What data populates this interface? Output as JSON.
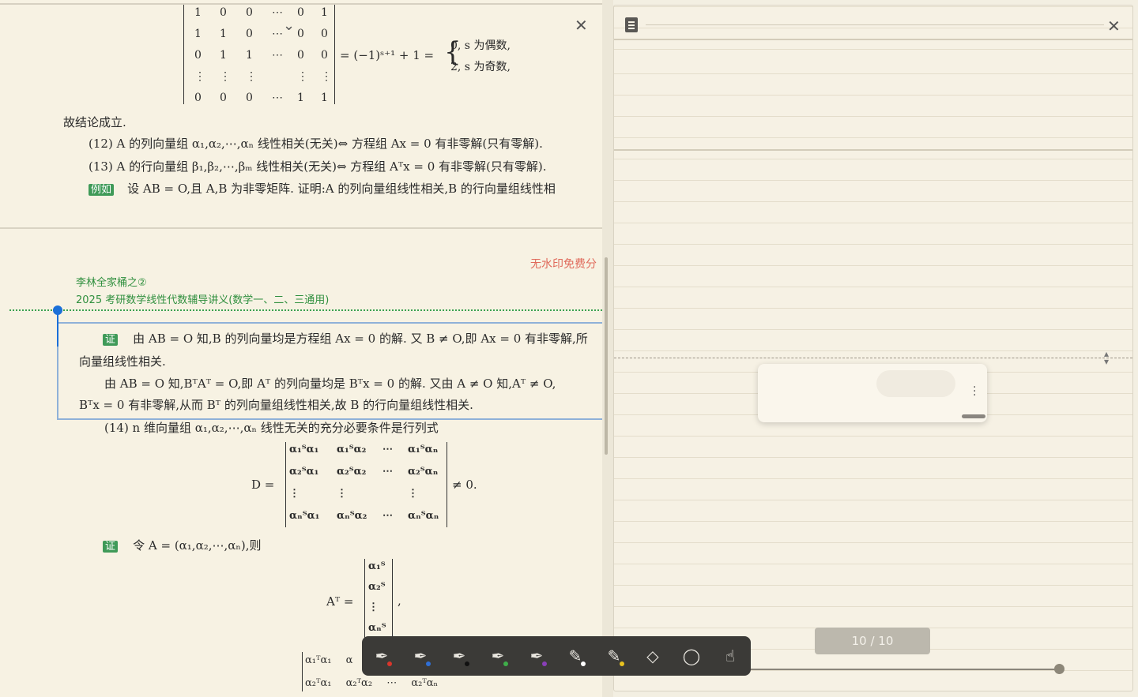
{
  "doc": {
    "matrix_rows": [
      [
        "1",
        "0",
        "0",
        "⋯",
        "0",
        "1"
      ],
      [
        "1",
        "1",
        "0",
        "⋯",
        "0",
        "0"
      ],
      [
        "0",
        "1",
        "1",
        "⋯",
        "0",
        "0"
      ],
      [
        "⋮",
        "⋮",
        "⋮",
        "",
        "⋮",
        "⋮"
      ],
      [
        "0",
        "0",
        "0",
        "⋯",
        "1",
        "1"
      ]
    ],
    "eq_rhs": "= (−1)ˢ⁺¹ + 1 =",
    "case1": "0,   s 为偶数,",
    "case2": "2,   s 为奇数,",
    "conclusion": "故结论成立.",
    "item12": "(12) A 的列向量组 α₁,α₂,⋯,αₙ 线性相关(无关)⇔ 方程组 Ax = 0 有非零解(只有零解).",
    "item13": "(13) A 的行向量组 β₁,β₂,⋯,βₘ 线性相关(无关)⇔ 方程组 Aᵀx = 0 有非零解(只有零解).",
    "example_tag": "例如",
    "example_text": "设 AB = O,且 A,B 为非零矩阵. 证明:A 的列向量组线性相关,B 的行向量组线性相",
    "watermark": "无水印免费分",
    "header_line1": "李林全家桶之②",
    "header_line2": "2025 考研数学线性代数辅导讲义(数学一、二、三通用)",
    "proof_tag": "证",
    "proof_p1a": "由 AB = O 知,B 的列向量均是方程组 Ax = 0 的解. 又 B ≠ O,即 Ax = 0 有非零解,所",
    "proof_p1b": "向量组线性相关.",
    "proof_p2a": "由 AB = O 知,BᵀAᵀ = O,即 Aᵀ 的列向量均是 Bᵀx = 0 的解. 又由 A ≠ O 知,Aᵀ ≠ O,",
    "proof_p2b": "Bᵀx = 0 有非零解,从而 Bᵀ 的列向量组线性相关,故 B 的行向量组线性相关.",
    "item14": "(14) n 维向量组 α₁,α₂,⋯,αₙ 线性无关的充分必要条件是行列式",
    "D_label": "D =",
    "D_rows": [
      [
        "α₁ᵀα₁",
        "α₁ᵀα₂",
        "⋯",
        "α₁ᵀαₙ"
      ],
      [
        "α₂ᵀα₁",
        "α₂ᵀα₂",
        "⋯",
        "α₂ᵀαₙ"
      ],
      [
        "⋮",
        "⋮",
        "",
        "⋮"
      ],
      [
        "αₙᵀα₁",
        "αₙᵀα₂",
        "⋯",
        "αₙᵀαₙ"
      ]
    ],
    "D_neq": "≠ 0.",
    "proof2_tag": "证",
    "proof2_text": "令 A = (α₁,α₂,⋯,αₙ),则",
    "AT_label": "Aᵀ =",
    "AT_rows": [
      "α₁ᵀ",
      "α₂ᵀ",
      "⋮",
      "αₙᵀ"
    ],
    "AT_comma": ",",
    "bottom_rows": [
      [
        "α₁ᵀα₁",
        "α"
      ],
      [
        "α₂ᵀα₁",
        "α₂ᵀα₂",
        "⋯",
        "α₂ᵀαₙ"
      ]
    ]
  },
  "notes": {
    "page_indicator": "10 / 10"
  },
  "toolbar": {
    "tools": [
      {
        "name": "pen-red-icon",
        "glyph": "✒",
        "dot": "#d9352b"
      },
      {
        "name": "pen-blue-icon",
        "glyph": "✒",
        "dot": "#2f6fd6"
      },
      {
        "name": "pen-black-icon",
        "glyph": "✒",
        "dot": "#111111"
      },
      {
        "name": "pen-green-icon",
        "glyph": "✒",
        "dot": "#3fae4a"
      },
      {
        "name": "pen-purple-icon",
        "glyph": "✒",
        "dot": "#8a3fb8"
      },
      {
        "name": "highlighter-icon",
        "glyph": "✎",
        "dot": "#ffffff"
      },
      {
        "name": "pencil-icon",
        "glyph": "✎",
        "dot": "#e8c21f"
      },
      {
        "name": "eraser-icon",
        "glyph": "◇",
        "dot": ""
      },
      {
        "name": "lasso-icon",
        "glyph": "◯",
        "dot": ""
      },
      {
        "name": "hand-icon",
        "glyph": "☝",
        "dot": ""
      }
    ]
  },
  "colors": {
    "accent_blue": "#1a6fd8",
    "green": "#2f8f3e",
    "watermark_red": "#e06a5b"
  }
}
